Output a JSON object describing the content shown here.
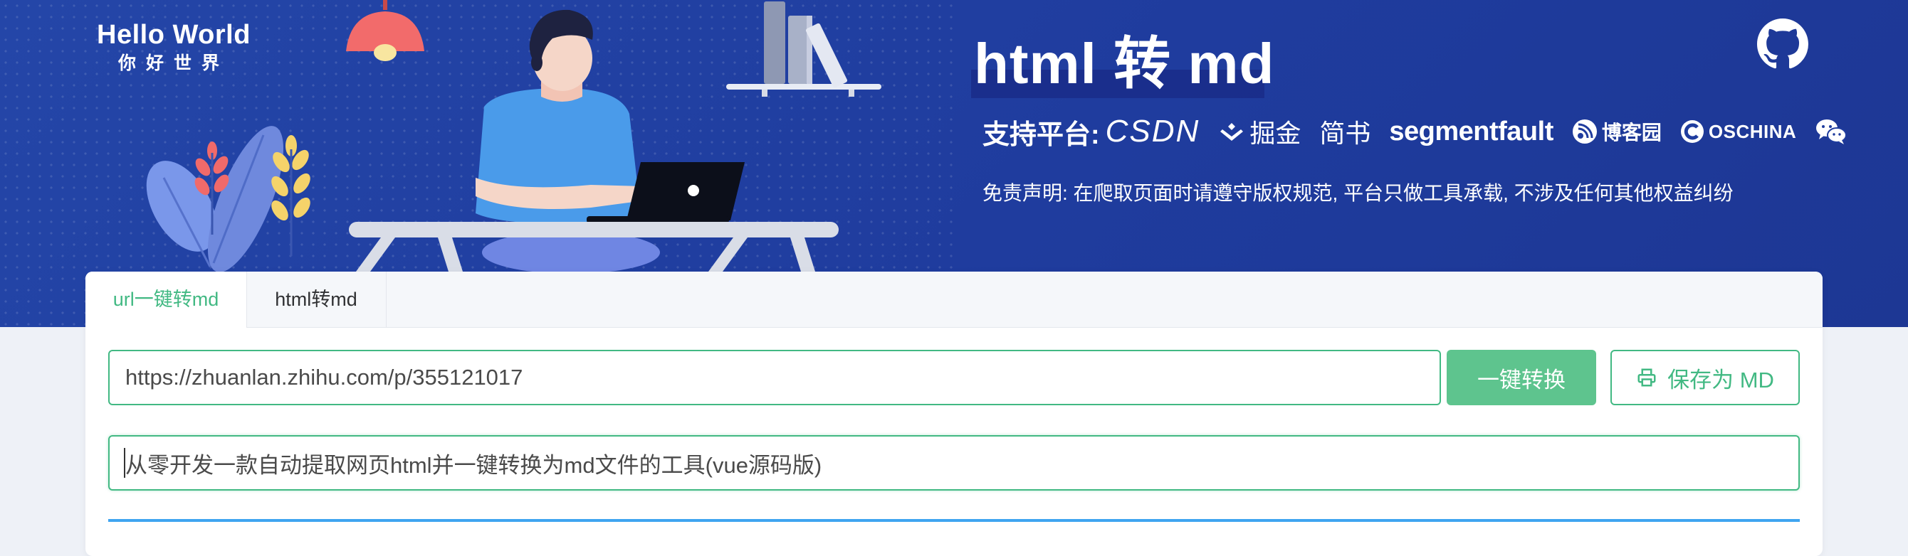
{
  "logo": {
    "title": "Hello World",
    "subtitle": "你好世界"
  },
  "header": {
    "title": "html 转 md",
    "platforms_label": "支持平台:",
    "platforms": [
      "CSDN",
      "掘金",
      "简书",
      "segmentfault",
      "博客园",
      "OSCHINA",
      "微信"
    ],
    "disclaimer": "免责声明: 在爬取页面时请遵守版权规范, 平台只做工具承载, 不涉及任何其他权益纠纷"
  },
  "tabs": [
    {
      "label": "url一键转md",
      "active": true
    },
    {
      "label": "html转md",
      "active": false
    }
  ],
  "url_input": {
    "value": "https://zhuanlan.zhihu.com/p/355121017"
  },
  "buttons": {
    "convert": "一键转换",
    "save": "保存为 MD"
  },
  "title_input": {
    "value": "从零开发一款自动提取网页html并一键转换为md文件的工具(vue源码版)"
  },
  "icons": {
    "github": "github-icon",
    "save": "printer-icon",
    "juejin": "juejin-icon",
    "cnblogs": "cnblogs-icon",
    "oschina": "oschina-icon",
    "wechat": "wechat-icon"
  },
  "colors": {
    "hero_bg": "#2446a8",
    "accent": "#42b983",
    "button": "#5ec48e",
    "editor_border": "#3fa5f0"
  }
}
